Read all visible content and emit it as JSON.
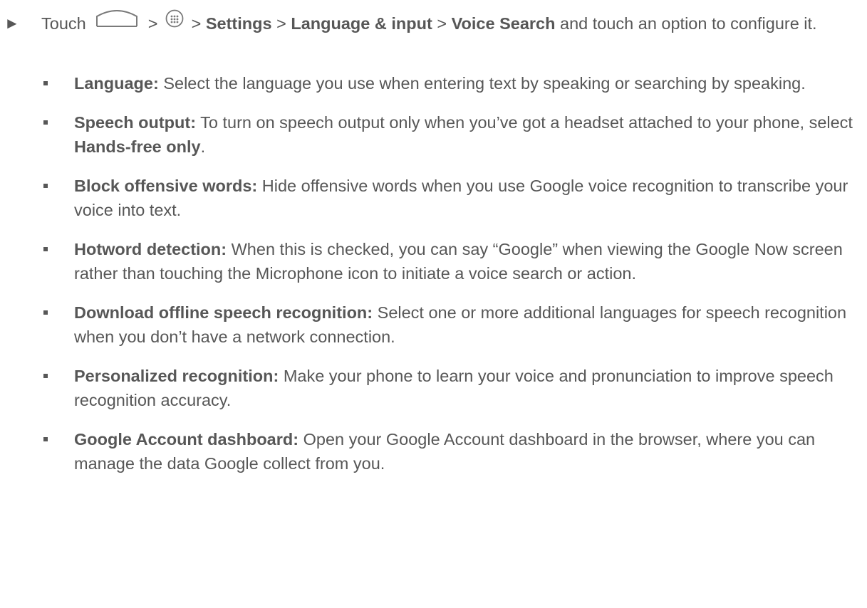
{
  "step": {
    "prefix": "Touch",
    "sep1": ">",
    "sep2": ">",
    "settings": "Settings",
    "sep3": ">",
    "language_input": "Language & input",
    "sep4": ">",
    "voice_search": "Voice Search",
    "suffix": "and touch an option to configure it.",
    "icons": [
      "home-icon",
      "apps-icon"
    ]
  },
  "items": [
    {
      "term": "Language:",
      "text": "Select the language you use when entering text by speaking or searching by speaking."
    },
    {
      "term": "Speech output:",
      "text": "To turn on speech output only when you’ve got a headset attached to your phone, select",
      "bold_tail": "Hands-free only",
      "tail": "."
    },
    {
      "term": "Block offensive words:",
      "text": "Hide offensive words when you use Google voice recognition to transcribe your voice into text."
    },
    {
      "term": "Hotword detection:",
      "text": "When this is checked, you can say “Google” when viewing the Google Now screen rather than touching the Microphone icon to initiate a voice search or action."
    },
    {
      "term": "Download offline speech recognition:",
      "text": "Select one or more additional languages for speech recognition when you don’t have a network connection."
    },
    {
      "term": "Personalized recognition:",
      "text": "Make your phone to learn your voice and pronunciation to improve speech recognition accuracy."
    },
    {
      "term": "Google Account dashboard:",
      "text": "Open your Google Account dashboard in the browser, where you can manage the data Google collect from you."
    }
  ]
}
